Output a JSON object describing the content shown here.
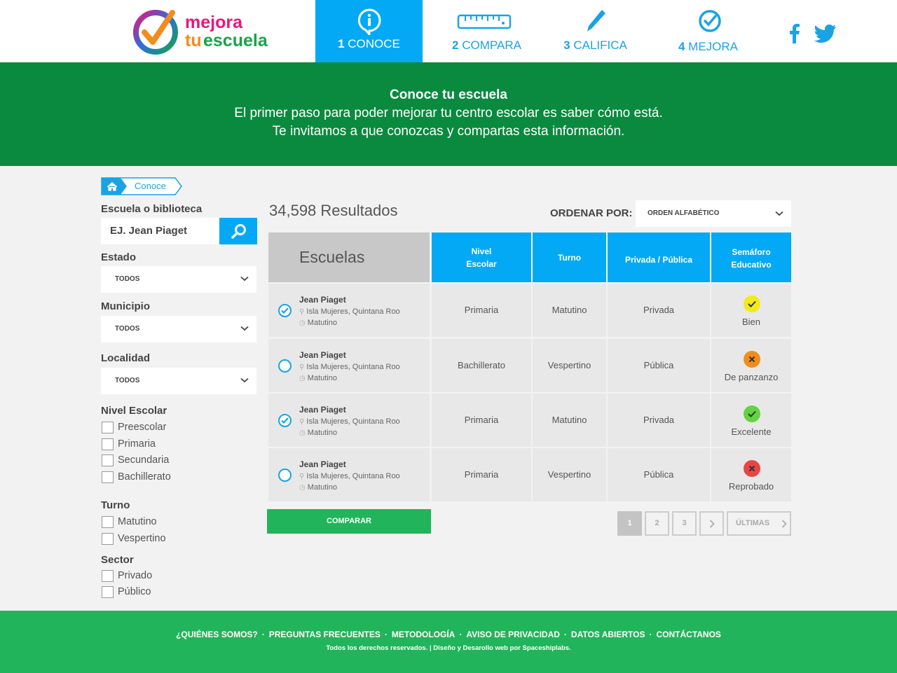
{
  "brand": {
    "line1": "mejora",
    "line2_a": "tu",
    "line2_b": "escuela"
  },
  "nav": [
    {
      "num": "1",
      "label": "CONOCE",
      "icon": "info-pin-icon"
    },
    {
      "num": "2",
      "label": "COMPARA",
      "icon": "ruler-icon"
    },
    {
      "num": "3",
      "label": "CALIFICA",
      "icon": "pen-icon"
    },
    {
      "num": "4",
      "label": "MEJORA",
      "icon": "check-circle-icon"
    }
  ],
  "social": [
    "facebook-icon",
    "twitter-icon"
  ],
  "banner": {
    "title": "Conoce tu escuela",
    "line1": "El primer paso para poder mejorar tu centro escolar es saber cómo está.",
    "line2": "Te invitamos a que conozcas y compartas esta información."
  },
  "breadcrumb": {
    "current": "Conoce"
  },
  "filters": {
    "search_label": "Escuela o biblioteca",
    "search_value": "EJ. Jean Piaget",
    "estado_label": "Estado",
    "estado_value": "TODOS",
    "municipio_label": "Municipio",
    "municipio_value": "TODOS",
    "localidad_label": "Localidad",
    "localidad_value": "TODOS",
    "nivel_label": "Nivel Escolar",
    "nivel_options": [
      "Preescolar",
      "Primaria",
      "Secundaria",
      "Bachillerato"
    ],
    "turno_label": "Turno",
    "turno_options": [
      "Matutino",
      "Vespertino"
    ],
    "sector_label": "Sector",
    "sector_options": [
      "Privado",
      "Público"
    ]
  },
  "results": {
    "count_text": "34,598 Resultados",
    "sort_label": "ORDENAR POR:",
    "sort_value": "ORDEN ALFABÉTICO"
  },
  "table": {
    "headers": {
      "escuelas": "Escuelas",
      "nivel_1": "Nivel",
      "nivel_2": "Escolar",
      "turno": "Turno",
      "sector": "Privada / Pública",
      "semaforo_1": "Semáforo",
      "semaforo_2": "Educativo"
    },
    "rows": [
      {
        "name": "Jean Piaget",
        "address": "Isla Mujeres, Quintana Roo",
        "shift": "Matutino",
        "nivel": "Primaria",
        "turno": "Matutino",
        "sector": "Privada",
        "semaforo": "Bien",
        "sem_color": "#f2ea1b",
        "sem_icon": "check-icon",
        "selected": true
      },
      {
        "name": "Jean Piaget",
        "address": "Isla Mujeres, Quintana Roo",
        "shift": "Matutino",
        "nivel": "Bachillerato",
        "turno": "Vespertino",
        "sector": "Pública",
        "semaforo": "De panzanzo",
        "sem_color": "#f28c1b",
        "sem_icon": "x-icon",
        "selected": false
      },
      {
        "name": "Jean Piaget",
        "address": "Isla Mujeres, Quintana Roo",
        "shift": "Matutino",
        "nivel": "Primaria",
        "turno": "Matutino",
        "sector": "Privada",
        "semaforo": "Excelente",
        "sem_color": "#62d442",
        "sem_icon": "check-icon",
        "selected": true
      },
      {
        "name": "Jean Piaget",
        "address": "Isla Mujeres, Quintana Roo",
        "shift": "Matutino",
        "nivel": "Primaria",
        "turno": "Vespertino",
        "sector": "Pública",
        "semaforo": "Reprobado",
        "sem_color": "#e84545",
        "sem_icon": "x-icon",
        "selected": false
      }
    ]
  },
  "compare_button": "COMPARAR",
  "pagination": {
    "pages": [
      "1",
      "2",
      "3"
    ],
    "current": "1",
    "last": "ÚLTIMAS"
  },
  "footer": {
    "links": [
      "¿QUIÉNES SOMOS?",
      "PREGUNTAS FRECUENTES",
      "METODOLOGÍA",
      "AVISO DE PRIVACIDAD",
      "DATOS ABIERTOS",
      "CONTÁCTANOS"
    ],
    "separator": "·",
    "credits": "Todos los derechos reservados. | Diseño y Desarollo web por Spaceshiplabs."
  },
  "colors": {
    "primary_blue": "#03a9f4",
    "banner_green": "#0a8a3f",
    "footer_green": "#22b45a",
    "compare_green": "#22b45a"
  }
}
